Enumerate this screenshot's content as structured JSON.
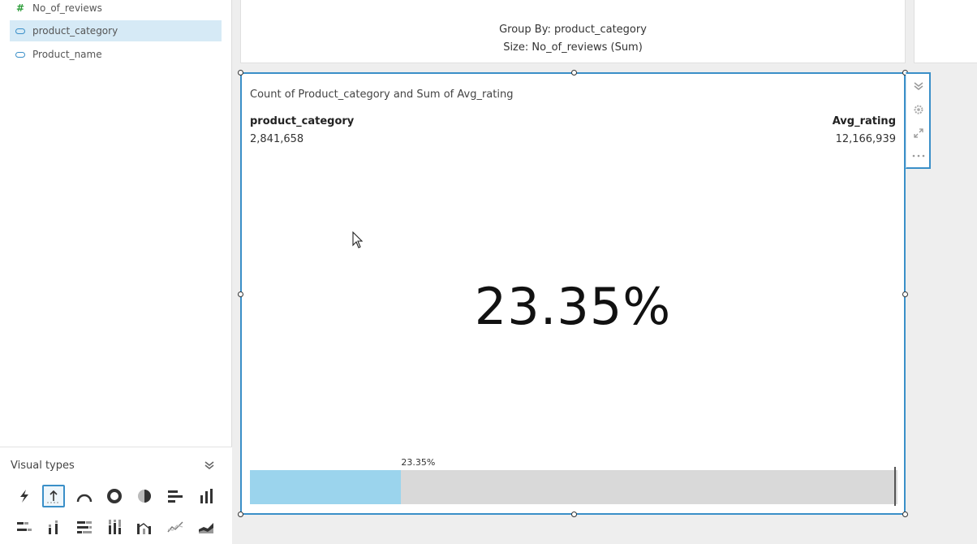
{
  "fields": [
    {
      "name": "No_of_reviews",
      "type": "measure",
      "icon": "hash-icon",
      "selected": false
    },
    {
      "name": "product_category",
      "type": "dimension",
      "icon": "dimension-icon",
      "selected": true
    },
    {
      "name": "Product_name",
      "type": "dimension",
      "icon": "dimension-icon",
      "selected": false
    }
  ],
  "visual_types": {
    "title": "Visual types",
    "icons": [
      "autograph-icon",
      "kpi-icon",
      "gauge-icon",
      "donut-icon",
      "pie-icon",
      "horizontal-bar-icon",
      "vertical-bar-icon",
      "stacked-horizontal-bar-icon",
      "stacked-vertical-bar-icon",
      "percent-horizontal-bar-icon",
      "percent-vertical-bar-icon",
      "combo-chart-icon",
      "line-chart-icon",
      "area-chart-icon"
    ],
    "selected_icon": "kpi-icon"
  },
  "top_visual": {
    "group_by_text": "Group By: product_category",
    "size_text": "Size: No_of_reviews (Sum)"
  },
  "main_visual": {
    "title": "Count of Product_category and Sum of Avg_rating",
    "left_metric_label": "product_category",
    "left_metric_value": "2,841,658",
    "right_metric_label": "Avg_rating",
    "right_metric_value": "12,166,939",
    "big_value": "23.35%",
    "progress_label": "23.35%",
    "progress_fraction": 0.2335
  },
  "toolbar": {
    "buttons": [
      "collapse-icon",
      "settings-icon",
      "expand-icon",
      "more-options-icon"
    ]
  },
  "colors": {
    "accent": "#3a8fc8",
    "progress_fill": "#9bd4ed",
    "progress_track": "#d9d9d9",
    "selected_field_bg": "#d6eaf6"
  }
}
